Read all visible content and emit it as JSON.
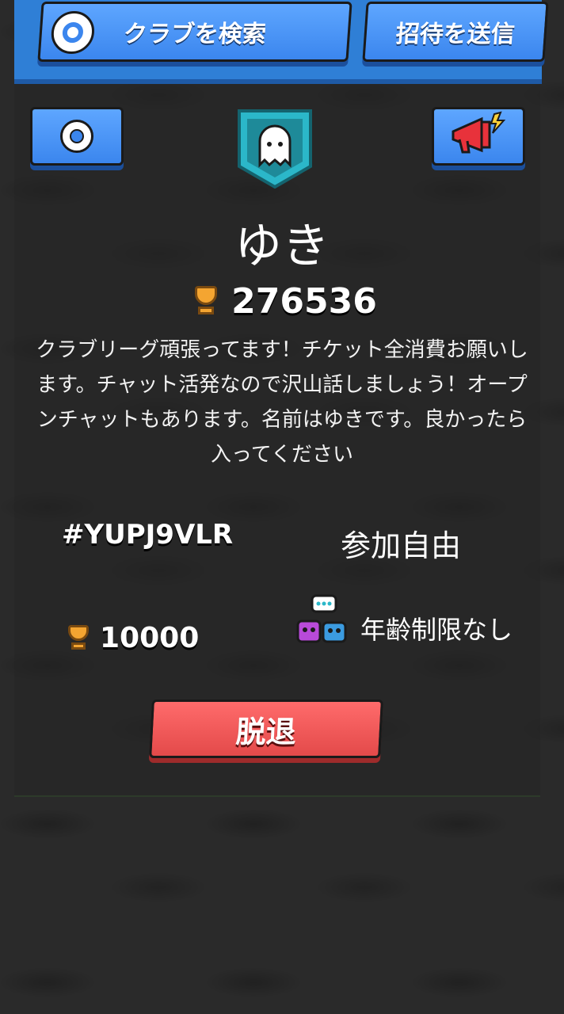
{
  "top_bar": {
    "search_label": "クラブを検索",
    "invite_label": "招待を送信"
  },
  "icons": {
    "search": "search-icon",
    "settings": "gear-icon",
    "badge": "ghost-icon",
    "announce": "megaphone-icon",
    "trophy": "trophy-icon",
    "age": "chat-friends-icon"
  },
  "club": {
    "name": "ゆき",
    "total_trophies": "276536",
    "description": "クラブリーグ頑張ってます！チケット全消費お願いします。チャット活発なので沢山話しましょう！オープンチャットもあります。名前はゆきです。良かったら入ってください",
    "tag": "#YUPJ9VLR",
    "join_type": "参加自由",
    "required_trophies": "10000",
    "age_restriction": "年齢制限なし"
  },
  "actions": {
    "leave_label": "脱退"
  },
  "colors": {
    "button_blue": "#3b86ee",
    "button_red": "#e34a4a",
    "badge_teal": "#2bb7c9",
    "trophy_gold": "#f4a531"
  }
}
